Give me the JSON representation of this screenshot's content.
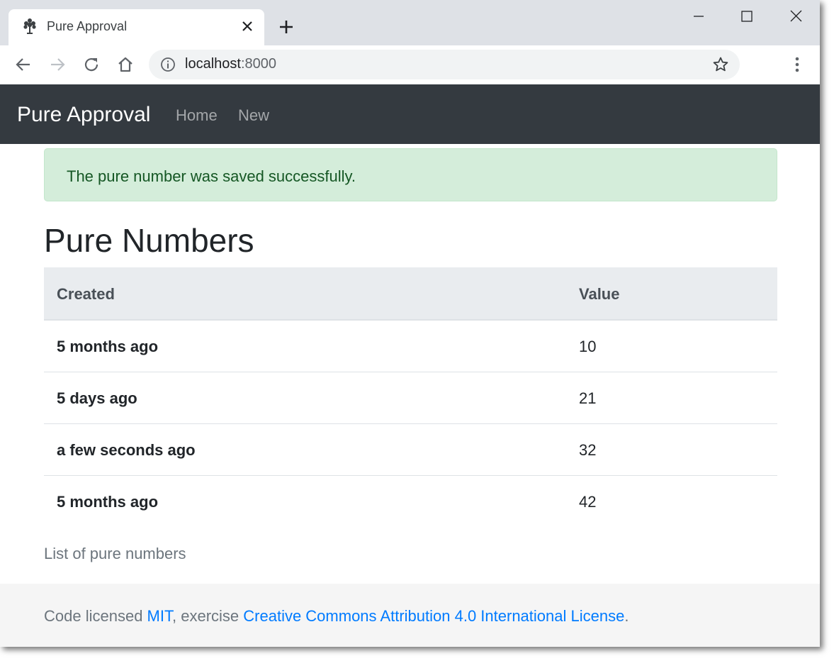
{
  "browser": {
    "tab_title": "Pure Approval",
    "url_host": "localhost",
    "url_port": ":8000",
    "favicon": "tree-icon"
  },
  "navbar": {
    "brand": "Pure Approval",
    "links": [
      "Home",
      "New"
    ]
  },
  "alert": {
    "message": "The pure number was saved successfully."
  },
  "main": {
    "title": "Pure Numbers",
    "table": {
      "headers": [
        "Created",
        "Value"
      ],
      "rows": [
        {
          "created": "5 months ago",
          "value": "10"
        },
        {
          "created": "5 days ago",
          "value": "21"
        },
        {
          "created": "a few seconds ago",
          "value": "32"
        },
        {
          "created": "5 months ago",
          "value": "42"
        }
      ]
    },
    "caption": "List of pure numbers"
  },
  "footer": {
    "prefix": "Code licensed ",
    "mit_link": "MIT",
    "middle": ", exercise ",
    "cc_link": "Creative Commons Attribution 4.0 International License",
    "suffix": "."
  },
  "colors": {
    "navbar_bg": "#343a40",
    "alert_bg": "#d4edda",
    "alert_text": "#155724",
    "link": "#007bff",
    "table_header_bg": "#e9ecef",
    "footer_bg": "#f5f5f5"
  }
}
